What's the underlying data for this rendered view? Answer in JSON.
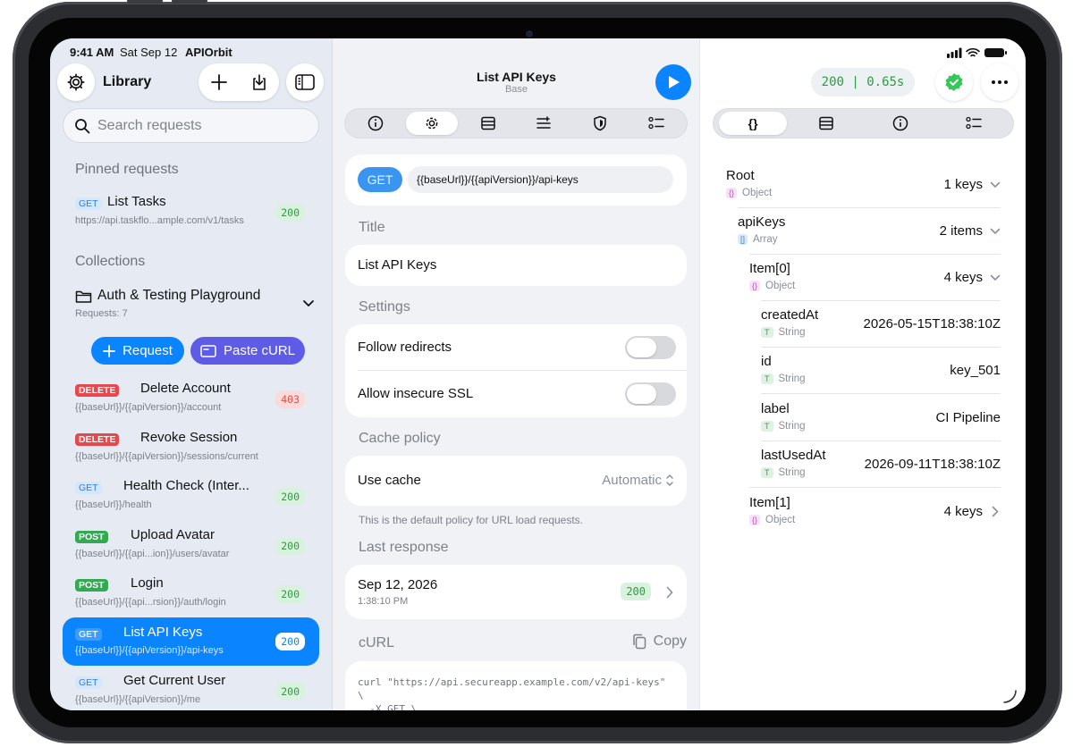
{
  "status_bar": {
    "time": "9:41 AM",
    "date": "Sat Sep 12",
    "app": "APIOrbit"
  },
  "sidebar": {
    "title": "Library",
    "search_placeholder": "Search requests",
    "pinned_header": "Pinned requests",
    "pinned": [
      {
        "method": "GET",
        "name": "List Tasks",
        "url": "https://api.taskflo...ample.com/v1/tasks",
        "code": "200"
      }
    ],
    "collections_header": "Collections",
    "collection": {
      "name": "Auth & Testing Playground",
      "count": "Requests: 7"
    },
    "new_request_label": "Request",
    "paste_curl_label": "Paste cURL",
    "requests": [
      {
        "method": "DELETE",
        "name": "Delete Account",
        "url": "{{baseUrl}}/{{apiVersion}}/account",
        "code": "403"
      },
      {
        "method": "DELETE",
        "name": "Revoke Session",
        "url": "{{baseUrl}}/{{apiVersion}}/sessions/current",
        "code": ""
      },
      {
        "method": "GET",
        "name": "Health Check (Inter...",
        "url": "{{baseUrl}}/health",
        "code": "200"
      },
      {
        "method": "POST",
        "name": "Upload Avatar",
        "url": "{{baseUrl}}/{{api...ion}}/users/avatar",
        "code": "200"
      },
      {
        "method": "POST",
        "name": "Login",
        "url": "{{baseUrl}}/{{api...rsion}}/auth/login",
        "code": "200"
      },
      {
        "method": "GET",
        "name": "List API Keys",
        "url": "{{baseUrl}}/{{apiVersion}}/api-keys",
        "code": "200"
      },
      {
        "method": "GET",
        "name": "Get Current User",
        "url": "{{baseUrl}}/{{apiVersion}}/me",
        "code": "200"
      }
    ]
  },
  "editor": {
    "title": "List API Keys",
    "subtitle": "Base",
    "method": "GET",
    "url": "{{baseUrl}}/{{apiVersion}}/api-keys",
    "title_label": "Title",
    "title_value": "List API Keys",
    "settings_label": "Settings",
    "follow_redirects": "Follow redirects",
    "insecure_ssl": "Allow insecure SSL",
    "cache_label": "Cache policy",
    "use_cache": "Use cache",
    "cache_value": "Automatic",
    "cache_note": "This is the default policy for URL load requests.",
    "last_response_label": "Last response",
    "last_response_date": "Sep 12, 2026",
    "last_response_time": "1:38:10 PM",
    "last_response_code": "200",
    "curl_label": "cURL",
    "copy_label": "Copy",
    "curl_lines": [
      "curl \"https://api.secureapp.example.com/v2/api-keys\"",
      "\\",
      "  -X GET \\"
    ]
  },
  "response": {
    "status": "200 | 0.65s",
    "tree": [
      {
        "key": "Root",
        "type": "Object",
        "value": "1 keys"
      },
      {
        "key": "apiKeys",
        "type": "Array",
        "value": "2 items"
      },
      {
        "key": "Item[0]",
        "type": "Object",
        "value": "4 keys"
      },
      {
        "key": "createdAt",
        "type": "String",
        "value": "2026-05-15T18:38:10Z"
      },
      {
        "key": "id",
        "type": "String",
        "value": "key_501"
      },
      {
        "key": "label",
        "type": "String",
        "value": "CI Pipeline"
      },
      {
        "key": "lastUsedAt",
        "type": "String",
        "value": "2026-09-11T18:38:10Z"
      },
      {
        "key": "Item[1]",
        "type": "Object",
        "value": "4 keys"
      }
    ],
    "type_badges": {
      "object": "{}",
      "array": "[]",
      "string": "T"
    }
  },
  "colors": {
    "accent": "#0a84ff",
    "success": "#34c759",
    "danger": "#e5484d",
    "purple": "#5e5ce6"
  }
}
